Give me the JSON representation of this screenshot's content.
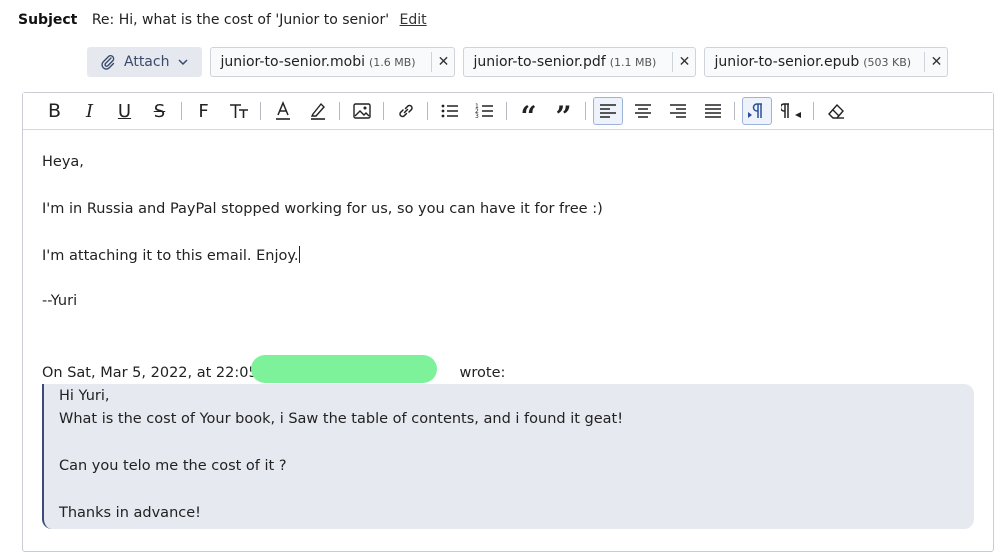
{
  "subject": {
    "label": "Subject",
    "text": "Re: Hi, what is the cost of 'Junior to senior'",
    "edit_label": "Edit"
  },
  "attach": {
    "button_label": "Attach",
    "files": [
      {
        "name": "junior-to-senior.mobi",
        "size": "(1.6 MB)"
      },
      {
        "name": "junior-to-senior.pdf",
        "size": "(1.1 MB)"
      },
      {
        "name": "junior-to-senior.epub",
        "size": "(503 KB)"
      }
    ]
  },
  "toolbar": {
    "buttons": [
      "bold",
      "italic",
      "underline",
      "strikethrough",
      "font-family",
      "font-size",
      "text-color",
      "highlight",
      "insert-image",
      "insert-link",
      "bulleted-list",
      "numbered-list",
      "quote-open",
      "quote-close",
      "align-left",
      "align-center",
      "align-right",
      "justify",
      "ltr",
      "rtl",
      "clear-formatting"
    ],
    "active": [
      "align-left",
      "ltr"
    ]
  },
  "message": {
    "greeting": "Heya,",
    "line1": "I'm in Russia and PayPal stopped working for us, so you can have it for free :)",
    "line2": "I'm attaching it to this email. Enjoy.",
    "signature": "--Yuri",
    "reply_prefix": "On Sat, Mar 5, 2022, at 22:05,",
    "reply_suffix": "wrote:"
  },
  "quote": {
    "line1": "Hi Yuri,",
    "line2": "What is the cost of Your book, i Saw the table of contents, and i found it geat!",
    "line3": "Can you telo me the cost of it ?",
    "line4": "Thanks in advance!"
  },
  "colors": {
    "redaction": "#7df29a",
    "quote_bg": "#e6e9f0",
    "quote_border": "#3c4a7a",
    "active_button": "#9db4d8"
  }
}
